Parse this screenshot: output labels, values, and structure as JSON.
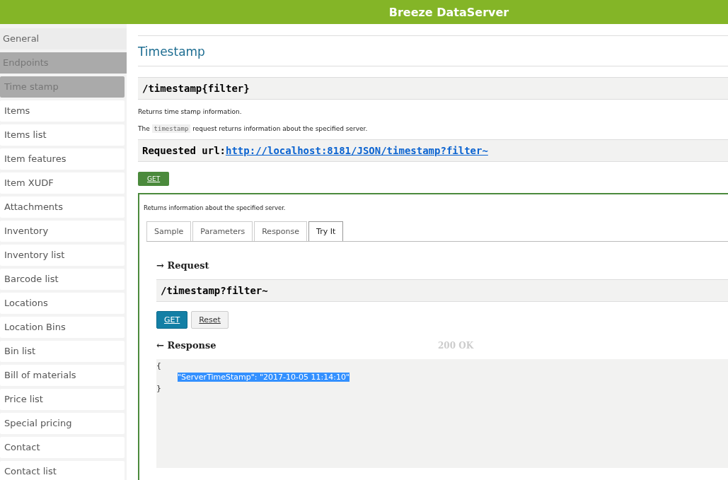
{
  "header": {
    "title": "Breeze DataServer"
  },
  "sidebar": {
    "items": [
      {
        "label": "General",
        "kind": "section",
        "selected": false
      },
      {
        "label": "Endpoints",
        "kind": "section",
        "selected": true
      },
      {
        "label": "Time stamp",
        "kind": "item",
        "selected": true
      },
      {
        "label": "Items",
        "kind": "item",
        "selected": false
      },
      {
        "label": "Items list",
        "kind": "item",
        "selected": false
      },
      {
        "label": "Item features",
        "kind": "item",
        "selected": false
      },
      {
        "label": "Item XUDF",
        "kind": "item",
        "selected": false
      },
      {
        "label": "Attachments",
        "kind": "item",
        "selected": false
      },
      {
        "label": "Inventory",
        "kind": "item",
        "selected": false
      },
      {
        "label": "Inventory list",
        "kind": "item",
        "selected": false
      },
      {
        "label": "Barcode list",
        "kind": "item",
        "selected": false
      },
      {
        "label": "Locations",
        "kind": "item",
        "selected": false
      },
      {
        "label": "Location Bins",
        "kind": "item",
        "selected": false
      },
      {
        "label": "Bin list",
        "kind": "item",
        "selected": false
      },
      {
        "label": "Bill of materials",
        "kind": "item",
        "selected": false
      },
      {
        "label": "Price list",
        "kind": "item",
        "selected": false
      },
      {
        "label": "Special pricing",
        "kind": "item",
        "selected": false
      },
      {
        "label": "Contact",
        "kind": "item",
        "selected": false
      },
      {
        "label": "Contact list",
        "kind": "item",
        "selected": false
      }
    ]
  },
  "main": {
    "title": "Timestamp",
    "endpoint": "/timestamp{filter}",
    "summary": "Returns time stamp information.",
    "description": {
      "before": "The",
      "code": "timestamp",
      "after": "request returns information about the specified server."
    },
    "requested_url": {
      "label": "Requested url:",
      "link": "http://localhost:8181/JSON/timestamp?filter~"
    },
    "method": "GET",
    "panel": {
      "description": "Returns information about the specified server.",
      "tabs": [
        {
          "label": "Sample",
          "selected": false
        },
        {
          "label": "Parameters",
          "selected": false
        },
        {
          "label": "Response",
          "selected": false
        },
        {
          "label": "Try It",
          "selected": true
        }
      ],
      "request_heading": "→ Request",
      "request_path": "/timestamp?filter~",
      "buttons": [
        {
          "label": "GET",
          "kind": "primary"
        },
        {
          "label": "Reset",
          "kind": "secondary"
        }
      ],
      "response_heading": "← Response",
      "status": "200 OK",
      "response_lines": [
        {
          "text": "{",
          "selected": false,
          "indent": false
        },
        {
          "text": "\"ServerTimeStamp\": \"2017-10-05 11:14:10\"",
          "selected": true,
          "indent": true
        },
        {
          "text": "}",
          "selected": false,
          "indent": false
        }
      ]
    }
  }
}
